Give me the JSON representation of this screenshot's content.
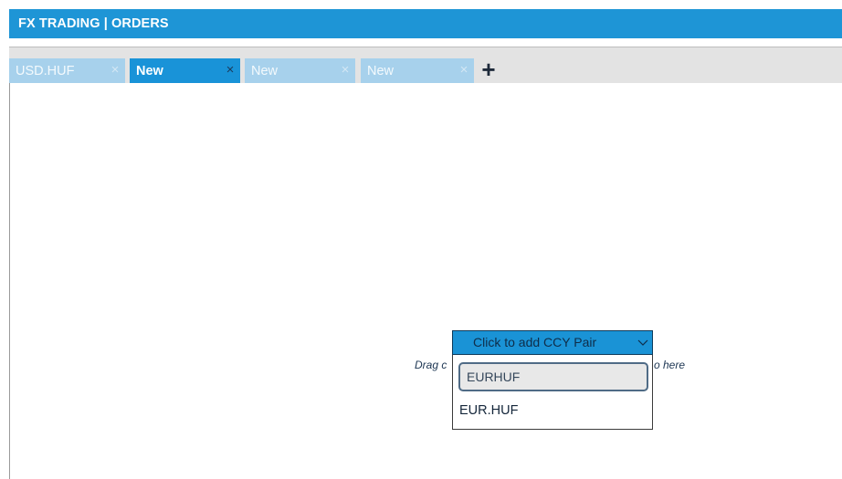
{
  "header": {
    "title": "FX TRADING | ORDERS"
  },
  "tabs": [
    {
      "label": "USD.HUF",
      "close": "×",
      "active": false
    },
    {
      "label": "New",
      "close": "×",
      "active": true
    },
    {
      "label": "New",
      "close": "×",
      "active": false
    },
    {
      "label": "New",
      "close": "×",
      "active": false
    }
  ],
  "add_tab_label": "+",
  "content": {
    "hint_left": "Drag c",
    "hint_right": "o here"
  },
  "ccy_picker": {
    "button_label": "Click to add CCY Pair",
    "chevron_icon": "chevron-down-icon",
    "search_value": "EURHUF",
    "options": [
      "EUR.HUF"
    ]
  },
  "colors": {
    "brand": "#1e95d6",
    "tab_inactive": "#a7d1ec",
    "tab_active": "#1993d8"
  }
}
